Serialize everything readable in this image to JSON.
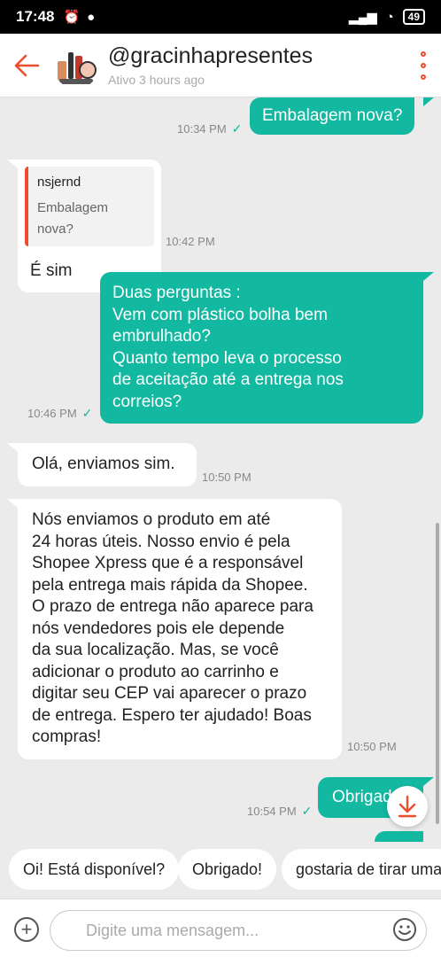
{
  "statusbar": {
    "time": "17:48",
    "battery": "49"
  },
  "header": {
    "name": "@gracinhapresentes",
    "status": "Ativo 3 hours ago"
  },
  "messages": [
    {
      "dir": "out",
      "text": "Embalagem nova?",
      "time": "10:34 PM"
    },
    {
      "dir": "in",
      "reply_name": "nsjernd",
      "reply_text": "Embalagem nova?",
      "text": "É sim",
      "time": "10:42 PM"
    },
    {
      "dir": "out",
      "lines": [
        "Duas perguntas :",
        "Vem com plástico bolha bem",
        "embrulhado?",
        "Quanto tempo leva o processo",
        "de aceitação até a entrega nos",
        "correios?"
      ],
      "time": "10:46 PM"
    },
    {
      "dir": "in",
      "text": "Olá, enviamos sim.",
      "time": "10:50 PM"
    },
    {
      "dir": "in",
      "lines": [
        "Nós enviamos o produto em até",
        "24 horas úteis. Nosso envio é pela",
        "Shopee Xpress que é a responsável",
        "pela entrega mais rápida da Shopee.",
        "O prazo de entrega não aparece para",
        "nós vendedores pois ele depende",
        "da sua localização. Mas, se você",
        "adicionar o produto ao carrinho e",
        "digitar seu CEP vai aparecer o prazo",
        "de entrega. Espero ter ajudado! Boas",
        "compras!"
      ],
      "time": "10:50 PM"
    },
    {
      "dir": "out",
      "text": "Obrigado!",
      "time": "10:54 PM"
    }
  ],
  "quick_replies": [
    "Oi! Está disponível?",
    "Obrigado!",
    "gostaria de tirar uma"
  ],
  "input": {
    "placeholder": "Digite uma mensagem..."
  },
  "colors": {
    "accent": "#ee4d2d",
    "bubble_out": "#12b8a0",
    "background": "#ebebeb"
  },
  "icons": [
    "back-arrow-icon",
    "more-menu-icon",
    "check-icon",
    "scroll-down-icon",
    "plus-icon",
    "emoji-icon"
  ]
}
